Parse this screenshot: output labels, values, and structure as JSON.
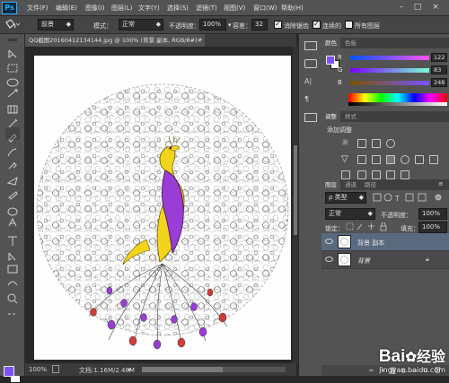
{
  "app": {
    "logo": "Ps",
    "menus": [
      "文件(F)",
      "编辑(E)",
      "图像(I)",
      "图层(L)",
      "文字(Y)",
      "选择(S)",
      "滤镜(T)",
      "视图(V)",
      "窗口(W)",
      "帮助(H)"
    ],
    "window_controls": [
      "–",
      "□",
      "×"
    ]
  },
  "options": {
    "fill_source": "前景",
    "mode_label": "模式：",
    "mode_value": "正常",
    "opacity_label": "不透明度：",
    "opacity_value": "100%",
    "tolerance_label": "容差：",
    "tolerance_value": "32",
    "antialias_label": "消除锯齿",
    "antialias_checked": true,
    "contiguous_label": "连续的",
    "contiguous_checked": true,
    "all_layers_label": "所有图层",
    "all_layers_checked": false
  },
  "document": {
    "tab_label": "QQ截图20160412134144.jpg @ 100% (背景 副本, RGB/8#) *",
    "close": "×",
    "zoom": "100%",
    "doc_info": "文档:1.16M/2.48M"
  },
  "color_panel": {
    "tabs": [
      "颜色",
      "色板"
    ],
    "channels": [
      {
        "label": "R",
        "value": "122"
      },
      {
        "label": "G",
        "value": "83"
      },
      {
        "label": "B",
        "value": "248"
      }
    ],
    "foreground": "#7a53f8",
    "background": "#ffffff"
  },
  "adjust_panel": {
    "tabs": [
      "调整",
      "样式"
    ],
    "title": "添加调整"
  },
  "layers_panel": {
    "tabs": [
      "图层",
      "通道",
      "路径"
    ],
    "kind_label": "ρ 类型",
    "blend_mode": "正常",
    "opacity_label": "不透明度：",
    "opacity_value": "100%",
    "lock_label": "锁定：",
    "fill_label": "填充：",
    "fill_value": "100%",
    "layers": [
      {
        "name": "背景 副本",
        "selected": true,
        "locked": false
      },
      {
        "name": "背景",
        "selected": false,
        "locked": true
      }
    ]
  },
  "watermark": {
    "brand": "Bai",
    "brand2": "经验",
    "url": "jingyan.baidu.com"
  },
  "colors": {
    "accent": "#31a8ff",
    "selected_layer": "#596a7f",
    "peacock_yellow": "#f2d41c",
    "peacock_purple": "#9a3cd6",
    "peacock_red": "#d43a3a"
  }
}
